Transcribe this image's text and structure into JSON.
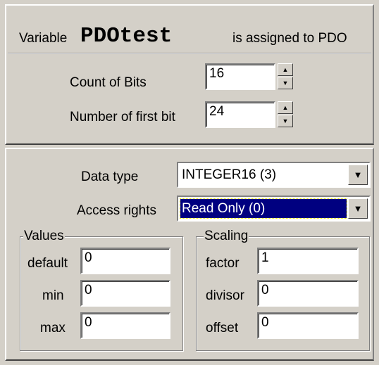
{
  "header": {
    "variable_label": "Variable",
    "variable_name": "PDOtest",
    "assigned_text": "is assigned to PDO"
  },
  "bits": {
    "count_label": "Count of Bits",
    "count_value": "16",
    "first_label": "Number of first bit",
    "first_value": "24"
  },
  "data_type": {
    "label": "Data type",
    "value": "INTEGER16 (3)"
  },
  "access_rights": {
    "label": "Access rights",
    "value": "Read Only (0)"
  },
  "values_group": {
    "legend": "Values",
    "default_label": "default",
    "default_value": "0",
    "min_label": "min",
    "min_value": "0",
    "max_label": "max",
    "max_value": "0"
  },
  "scaling_group": {
    "legend": "Scaling",
    "factor_label": "factor",
    "factor_value": "1",
    "divisor_label": "divisor",
    "divisor_value": "0",
    "offset_label": "offset",
    "offset_value": "0"
  },
  "icons": {
    "spin_up": "▲",
    "spin_down": "▼",
    "dropdown": "▼"
  },
  "colors": {
    "face": "#d4d0c8",
    "selection": "#000080"
  }
}
